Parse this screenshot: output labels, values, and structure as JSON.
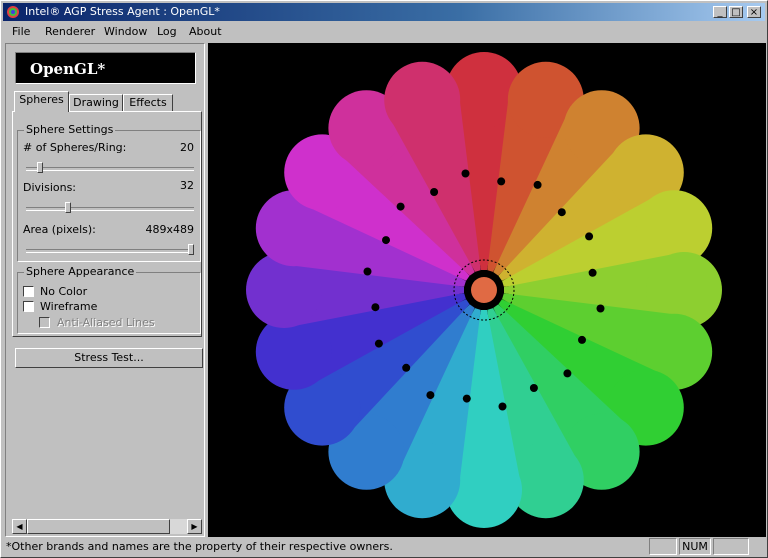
{
  "window": {
    "title": "Intel® AGP Stress Agent : OpenGL*"
  },
  "titlebar_buttons": {
    "minimize": "_",
    "maximize": "□",
    "close": "×"
  },
  "menu": [
    {
      "label": "File"
    },
    {
      "label": "Renderer"
    },
    {
      "label": "Window"
    },
    {
      "label": "Log"
    },
    {
      "label": "About"
    }
  ],
  "logo": {
    "text": "OpenGL*"
  },
  "tabs": [
    {
      "label": "Spheres",
      "active": true
    },
    {
      "label": "Drawing",
      "active": false
    },
    {
      "label": "Effects",
      "active": false
    }
  ],
  "sphere_settings": {
    "title": "Sphere Settings",
    "spheres_per_ring": {
      "label": "# of Spheres/Ring:",
      "value": "20",
      "slider_fraction": 0.07
    },
    "divisions": {
      "label": "Divisions:",
      "value": "32",
      "slider_fraction": 0.24
    },
    "area": {
      "label": "Area (pixels):",
      "value": "489x489",
      "slider_fraction": 1.0
    }
  },
  "sphere_appearance": {
    "title": "Sphere Appearance",
    "no_color": {
      "label": "No Color",
      "checked": false
    },
    "wireframe": {
      "label": "Wireframe",
      "checked": false
    },
    "anti_aliased": {
      "label": "Anti-Aliased Lines",
      "checked": false,
      "disabled": true
    }
  },
  "stress_button": {
    "label": "Stress Test..."
  },
  "scroll": {
    "left": "◀",
    "right": "▶"
  },
  "status": {
    "message": "*Other brands and names are the property of their respective owners.",
    "num": "NUM"
  },
  "render": {
    "background": "#000000",
    "spheres_per_ring": 20
  }
}
